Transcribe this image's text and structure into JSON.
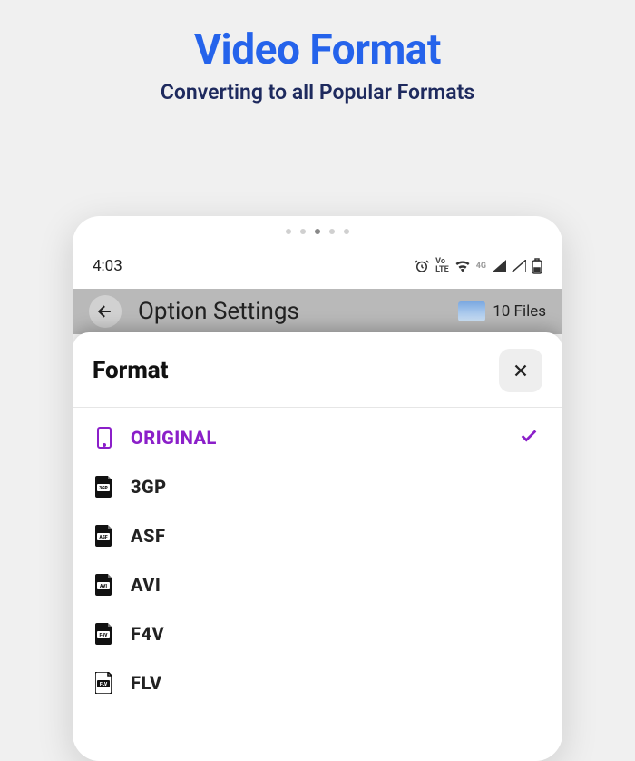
{
  "hero": {
    "title": "Video Format",
    "subtitle": "Converting to all Popular Formats"
  },
  "status": {
    "time": "4:03",
    "volte": "Vo\nLTE",
    "net": "4G"
  },
  "appHeader": {
    "title": "Option Settings",
    "filesLabel": "10 Files"
  },
  "sheet": {
    "title": "Format"
  },
  "formats": [
    {
      "label": "ORIGINAL",
      "badge": "",
      "selected": true
    },
    {
      "label": "3GP",
      "badge": "3GP",
      "selected": false
    },
    {
      "label": "ASF",
      "badge": "ASF",
      "selected": false
    },
    {
      "label": "AVI",
      "badge": "AVI",
      "selected": false
    },
    {
      "label": "F4V",
      "badge": "F4V",
      "selected": false
    },
    {
      "label": "FLV",
      "badge": "FLV",
      "selected": false
    }
  ]
}
